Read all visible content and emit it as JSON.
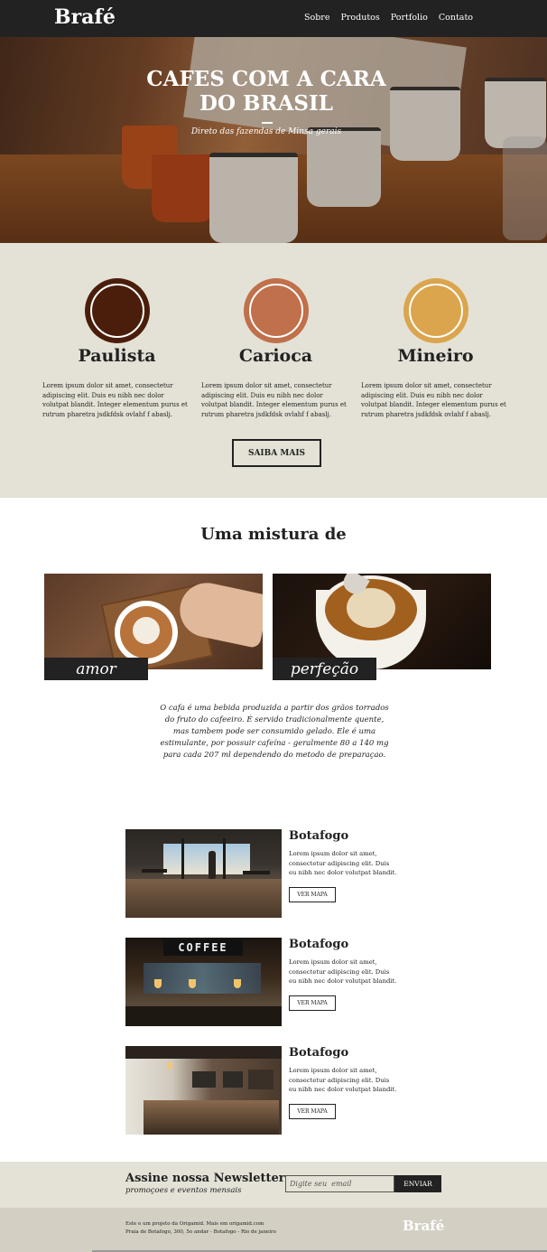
{
  "header": {
    "logo": "Brafé",
    "nav": [
      "Sobre",
      "Produtos",
      "Portfolio",
      "Contato"
    ]
  },
  "hero": {
    "title": "CAFES COM A CARA DO BRASIL",
    "subtitle": "Direto das fazendas de Minsa gerais"
  },
  "types": {
    "items": [
      {
        "name": "Paulista",
        "color": "#4a1e0a",
        "desc": "Lorem ipsum dolor sit amet, consectetur adipiscing elit. Duis eu nibh nec dolor volutpat blandit. Integer elementum purus et rutrum pharetra jsdkfdsk ovlahf f abaslj."
      },
      {
        "name": "Carioca",
        "color": "#c0704a",
        "desc": "Lorem ipsum dolor sit amet, consectetur adipiscing elit. Duis eu nibh nec dolor volutpat blandit. Integer elementum purus et rutrum pharetra jsdkfdsk ovlahf f abaslj."
      },
      {
        "name": "Mineiro",
        "color": "#dba54e",
        "desc": "Lorem ipsum dolor sit amet, consectetur adipiscing elit. Duis eu nibh nec dolor volutpat blandit. Integer elementum purus et rutrum pharetra jsdkfdsk ovlahf f abaslj."
      }
    ],
    "button": "SAIBA MAIS"
  },
  "mix": {
    "title": "Uma mistura de",
    "labels": [
      "amor",
      "perfeção"
    ],
    "text": "O cafa é uma bebida produzida a partir dos grãos torrados do fruto do cafeeiro. É servido tradicionalmente quente, mas tambem pode ser consumido gelado. Ele é uma estimulante, por possuir cafeína - geralmente 80 a 140 mg para cada 207 ml dependendo do metodo de preparaçao."
  },
  "locations": [
    {
      "title": "Botafogo",
      "desc": "Lorem ipsum dolor sit amet, consectetur adipiscing elit. Duis eu nibh nec dolor volutpat blandit.",
      "button": "VER MAPA"
    },
    {
      "title": "Botafogo",
      "desc": "Lorem ipsum dolor sit amet, consectetur adipiscing elit. Duis eu nibh nec dolor volutpat blandit.",
      "button": "VER MAPA",
      "sign": "COFFEE"
    },
    {
      "title": "Botafogo",
      "desc": "Lorem ipsum dolor sit amet, consectetur adipiscing elit. Duis eu nibh nec dolor volutpat blandit.",
      "button": "VER MAPA"
    }
  ],
  "newsletter": {
    "title": "Assine nossa Newsletter",
    "subtitle": "promoçoes e eventos mensais",
    "placeholder": "Digite seu  email",
    "button": "ENVIAR"
  },
  "footer": {
    "line1": "Este e um projeto da Origamid. Mais em origamid.com",
    "line2": "Praia de Botafogo, 300, 5o andar - Botafogo - Rio de janeiro",
    "logo": "Brafé"
  }
}
